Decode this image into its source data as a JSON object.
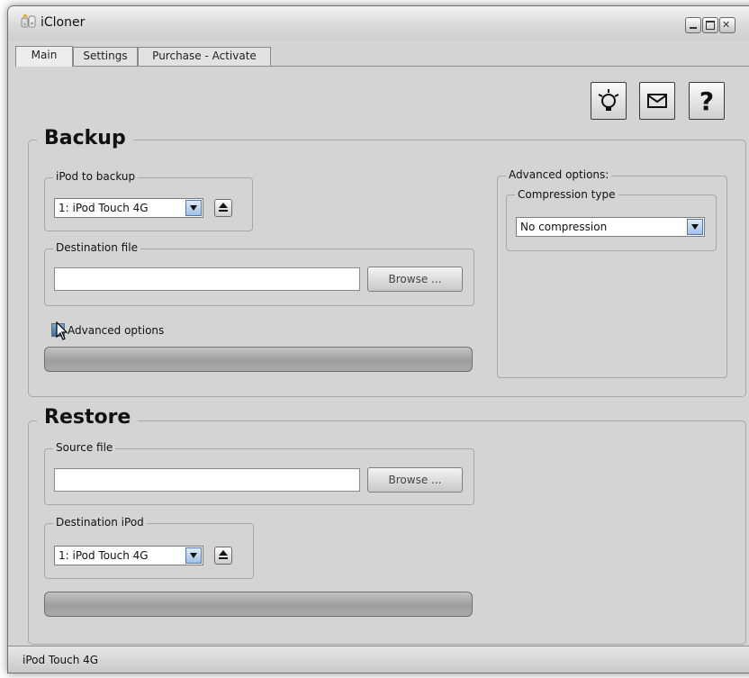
{
  "window": {
    "title": "iCloner"
  },
  "tabs": [
    {
      "label": "Main",
      "active": true
    },
    {
      "label": "Settings",
      "active": false
    },
    {
      "label": "Purchase - Activate",
      "active": false
    }
  ],
  "toolbar": {
    "icons": [
      "lightbulb-icon",
      "mail-icon",
      "help-icon"
    ],
    "help_glyph": "?"
  },
  "backup": {
    "title": "Backup",
    "ipod_group_label": "iPod to backup",
    "ipod_selected": "1: iPod Touch 4G",
    "destination_label": "Destination file",
    "destination_value": "",
    "browse_label": "Browse ...",
    "advanced_checkbox_label": "Advanced options",
    "advanced_checked": true,
    "progress": 0
  },
  "advanced": {
    "label": "Advanced options:",
    "compression_label": "Compression type",
    "compression_selected": "No compression"
  },
  "restore": {
    "title": "Restore",
    "source_label": "Source file",
    "source_value": "",
    "browse_label": "Browse ...",
    "destination_label": "Destination iPod",
    "ipod_selected": "1: iPod Touch 4G",
    "progress": 0
  },
  "status": {
    "text": "iPod Touch 4G"
  },
  "colors": {
    "window_bg": "#d4d4d4",
    "combo_arrow": "#9fc0e8",
    "progress_bar": "#a9a9a9"
  }
}
